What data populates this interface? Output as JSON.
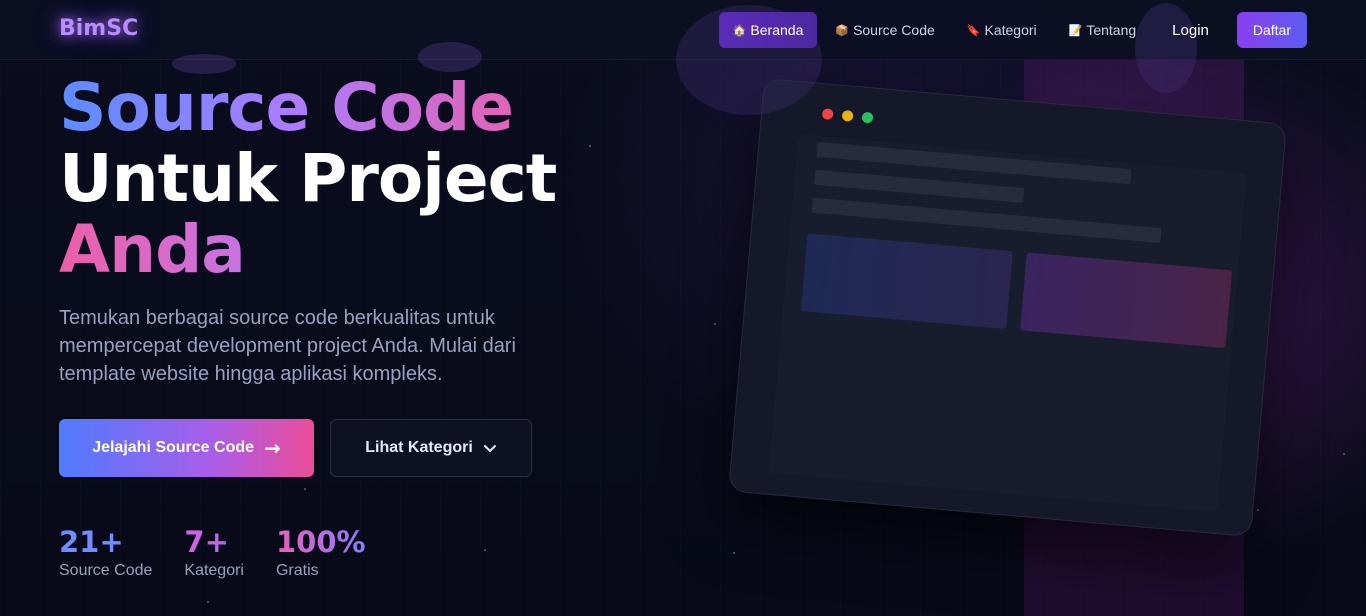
{
  "nav": {
    "logo": "BimSC",
    "items": [
      {
        "icon": "🏠",
        "label": "Beranda",
        "active": true
      },
      {
        "icon": "📦",
        "label": "Source Code",
        "active": false
      },
      {
        "icon": "🔖",
        "label": "Kategori",
        "active": false
      },
      {
        "icon": "📝",
        "label": "Tentang",
        "active": false
      }
    ],
    "login": "Login",
    "register": "Daftar"
  },
  "hero": {
    "title_line1": "Source Code",
    "title_line2": "Untuk Project",
    "title_line3": "Anda",
    "description": "Temukan berbagai source code berkualitas untuk mempercepat development project Anda. Mulai dari template website hingga aplikasi kompleks.",
    "primary_button": "Jelajahi Source Code",
    "primary_arrow": "→",
    "secondary_button": "Lihat Kategori",
    "secondary_chevron": "⌄"
  },
  "stats": [
    {
      "value": "21+",
      "label": "Source Code"
    },
    {
      "value": "7+",
      "label": "Kategori"
    },
    {
      "value": "100%",
      "label": "Gratis"
    }
  ],
  "mockup": {
    "window_dots": [
      "#ef4444",
      "#eab308",
      "#22c55e"
    ]
  }
}
